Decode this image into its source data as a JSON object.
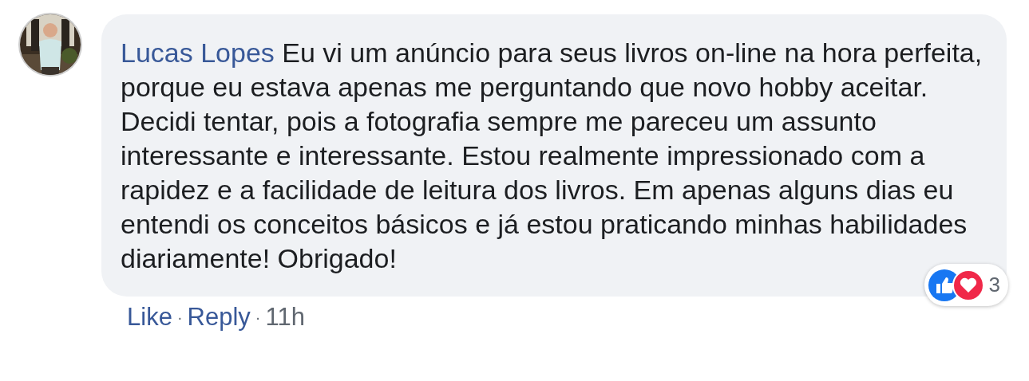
{
  "comment": {
    "author": "Lucas Lopes",
    "text": "Eu vi um anúncio para seus livros on-line na hora perfeita, porque eu estava apenas me perguntando que novo hobby aceitar. Decidi tentar, pois a fotografia sempre me pareceu um assunto interessante e interessante. Estou realmente impressionado com a rapidez e a facilidade de leitura dos livros. Em apenas alguns dias eu entendi os conceitos básicos e já estou praticando minhas habilidades diariamente! Obrigado!",
    "reaction_count": "3",
    "actions": [
      {
        "label": "Like",
        "kind": "link"
      },
      {
        "label": "·",
        "kind": "separator"
      },
      {
        "label": "Reply",
        "kind": "link"
      },
      {
        "label": "·",
        "kind": "separator"
      },
      {
        "label": "11h",
        "kind": "time"
      }
    ]
  }
}
